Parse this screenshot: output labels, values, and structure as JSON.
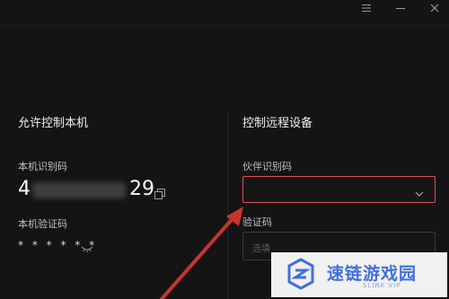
{
  "titlebar": {
    "menu_icon": "menu-icon",
    "minimize_icon": "minimize-icon",
    "close_icon": "close-icon"
  },
  "left_panel": {
    "title": "允许控制本机",
    "id_label": "本机识别码",
    "id_prefix": "4",
    "id_suffix": "29",
    "code_label": "本机验证码",
    "code_masked": "* * * * * *"
  },
  "right_panel": {
    "title": "控制远程设备",
    "partner_label": "伙伴识别码",
    "partner_value": "",
    "code_label": "验证码",
    "code_placeholder": "选填"
  },
  "watermark": {
    "text": "速链游戏园",
    "subtext": "SLINK VIP"
  },
  "colors": {
    "background": "#141414",
    "accent_border": "#e0515a",
    "arrow": "#c8342f",
    "watermark_blue": "#3f6fe0"
  }
}
